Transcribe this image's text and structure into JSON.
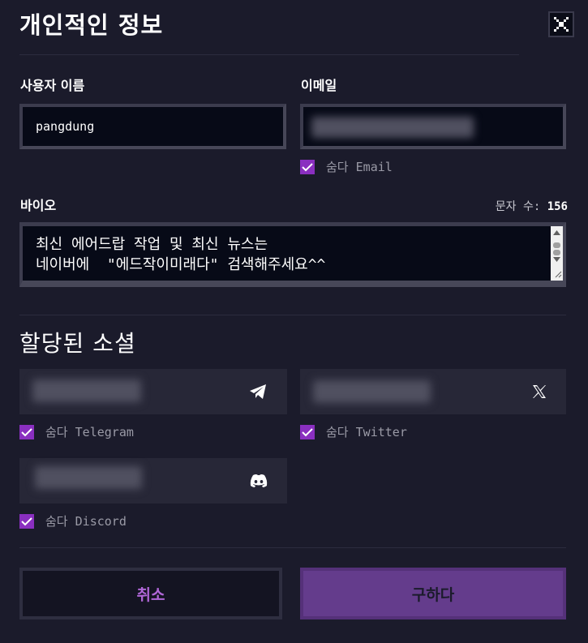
{
  "header": {
    "title": "개인적인 정보",
    "close_icon": "close-icon"
  },
  "username": {
    "label": "사용자 이름",
    "value": "pangdung"
  },
  "email": {
    "label": "이메일",
    "value": "",
    "hide_label": "숨다 Email",
    "hide_checked": true
  },
  "bio": {
    "label": "바이오",
    "char_count_label": "문자 수:",
    "char_count": "156",
    "value": "최신 에어드랍 작업 및 최신 뉴스는\n네이버에  \"에드작이미래다\" 검색해주세요^^"
  },
  "socials": {
    "title": "할당된 소셜",
    "items": [
      {
        "network": "Telegram",
        "icon": "telegram-icon",
        "hide_label": "숨다 Telegram",
        "hide_checked": true
      },
      {
        "network": "Twitter",
        "icon": "x-icon",
        "hide_label": "숨다 Twitter",
        "hide_checked": true
      },
      {
        "network": "Discord",
        "icon": "discord-icon",
        "hide_label": "숨다 Discord",
        "hide_checked": true
      }
    ]
  },
  "actions": {
    "cancel_label": "취소",
    "save_label": "구하다"
  },
  "colors": {
    "background": "#1b1b2b",
    "accent": "#8a2fc0",
    "save_button": "#643c8c",
    "cancel_text": "#b067d8"
  }
}
